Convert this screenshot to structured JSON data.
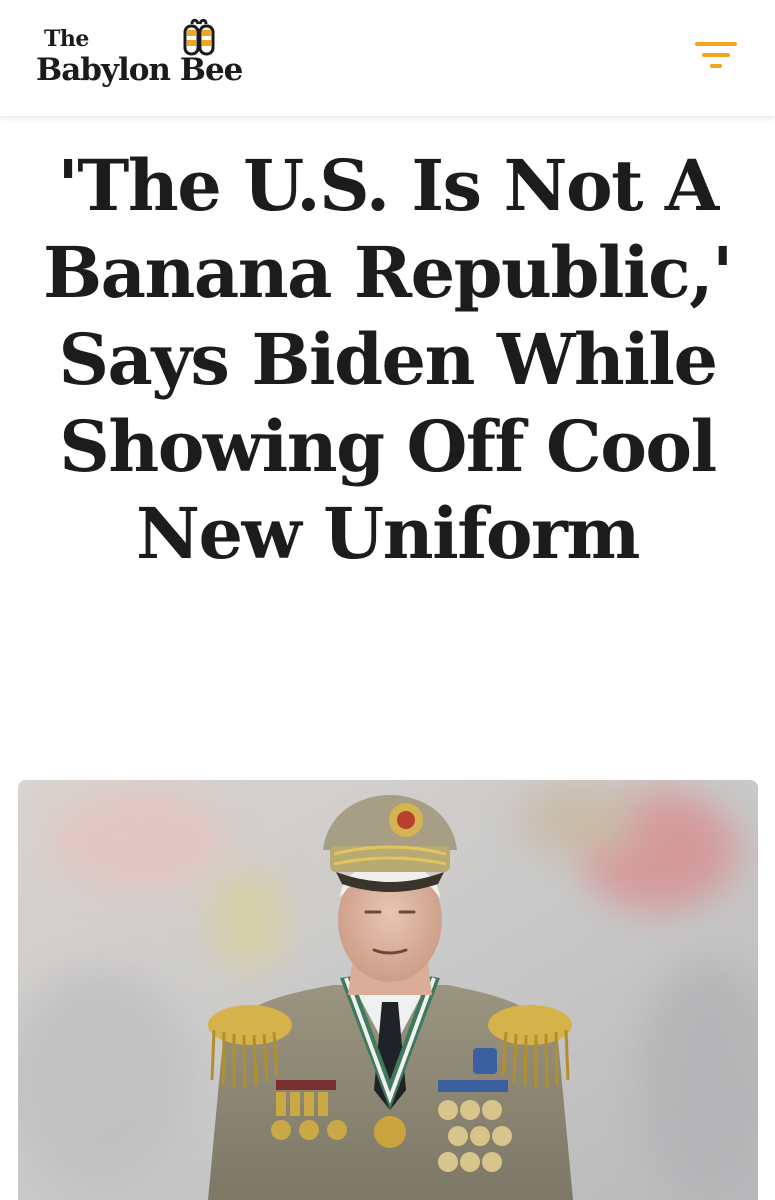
{
  "site": {
    "logo_top": "The",
    "logo_name": "Babylon Bee",
    "logo_icon": "bee-icon",
    "menu_icon": "filter-menu-icon",
    "accent_color": "#f2a51f"
  },
  "article": {
    "headline": "'The U.S. Is Not A Banana Republic,' Says Biden While Showing Off Cool New Uniform"
  }
}
